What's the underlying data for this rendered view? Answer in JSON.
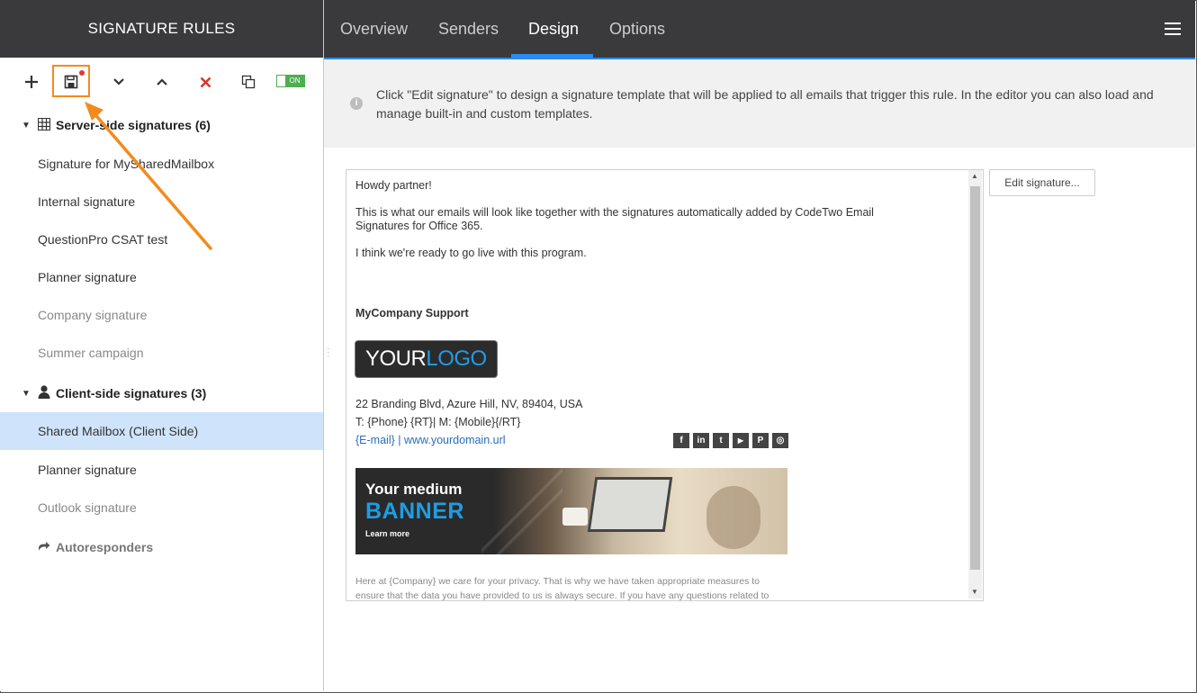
{
  "left_header": {
    "title": "SIGNATURE RULES"
  },
  "toolbar": {
    "toggle_label": "ON"
  },
  "groups": {
    "server": {
      "label": "Server-side signatures (6)"
    },
    "client": {
      "label": "Client-side signatures (3)"
    }
  },
  "server_items": [
    "Signature for MySharedMailbox",
    "Internal signature",
    "QuestionPro CSAT test",
    "Planner signature",
    "Company signature",
    "Summer campaign"
  ],
  "client_items": [
    "Shared Mailbox (Client Side)",
    "Planner signature",
    "Outlook signature"
  ],
  "autoresponders": {
    "label": "Autoresponders"
  },
  "tabs": [
    "Overview",
    "Senders",
    "Design",
    "Options"
  ],
  "active_tab": "Design",
  "info": {
    "text": "Click \"Edit signature\" to design a signature template that will be applied to all emails that trigger this rule. In the editor you can also load and manage built-in and custom templates."
  },
  "edit_button": {
    "label": "Edit signature..."
  },
  "preview": {
    "greeting": "Howdy partner!",
    "para1_line1": "This is what our emails will look like together with the signatures automatically added by CodeTwo Email",
    "para1_line2": "Signatures for Office 365.",
    "para2": "I think we're ready to go live with this program.",
    "company": "MyCompany Support",
    "logo_your": "YOUR",
    "logo_logo": "LOGO",
    "address": "22 Branding Blvd, Azure Hill, NV, 89404, USA",
    "phones": "T: {Phone} {RT}| M: {Mobile}{/RT}",
    "email_link": "{E-mail}",
    "separator": " | ",
    "domain_link": "www.yourdomain.url",
    "banner_line1": "Your medium",
    "banner_line2": "BANNER",
    "banner_line3": "Learn more",
    "privacy": "Here at {Company} we care for your privacy. That is why we have taken appropriate measures to ensure that the data you have provided to us is always secure. If you have any questions related to"
  },
  "social_icons": [
    "facebook-icon",
    "linkedin-icon",
    "twitter-icon",
    "youtube-icon",
    "pinterest-icon",
    "instagram-icon"
  ],
  "social_glyphs": [
    "f",
    "in",
    "t",
    "▶",
    "P",
    "◎"
  ],
  "colors": {
    "header_bg": "#3a3a3d",
    "accent_blue": "#2d8bf0",
    "highlight_orange": "#f28b1e",
    "selected_row": "#cfe4fb",
    "toggle_green": "#4caf50",
    "delete_red": "#d9341f",
    "link_blue": "#2a6ebb"
  }
}
